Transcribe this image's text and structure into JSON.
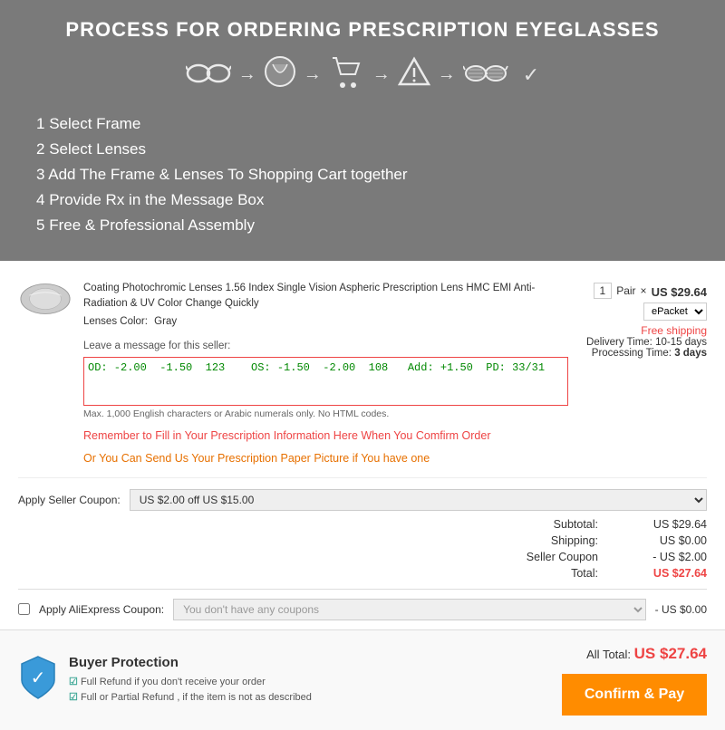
{
  "header": {
    "title": "PROCESS FOR ORDERING PRESCRIPTION EYEGLASSES",
    "steps": [
      {
        "label": "Select Frame",
        "number": "1"
      },
      {
        "label": "Select Lenses",
        "number": "2"
      },
      {
        "label": "Add The Frame & Lenses To Shopping Cart together",
        "number": "3"
      },
      {
        "label": "Provide Rx in the Message Box",
        "number": "4"
      },
      {
        "label": "Free & Professional Assembly",
        "number": "5"
      }
    ]
  },
  "product": {
    "name": "Coating Photochromic Lenses 1.56 Index Single Vision Aspheric Prescription Lens HMC EMI Anti-Radiation & UV Color Change Quickly",
    "lenses_color_label": "Lenses Color:",
    "lenses_color": "Gray",
    "qty": "1",
    "unit": "Pair",
    "price": "US $29.64",
    "shipping_method": "ePacket",
    "free_shipping": "Free shipping",
    "delivery_label": "Delivery Time:",
    "delivery_time": "10-15 days",
    "processing_label": "Processing Time:",
    "processing_time": "3 days"
  },
  "message": {
    "label": "Leave a message for this seller:",
    "content": "OD: -2.00  -1.50  123    OS: -1.50  -2.00  108   Add: +1.50  PD: 33/31",
    "hint": "Max. 1,000 English characters or Arabic numerals only. No HTML codes."
  },
  "warnings": {
    "fill_prescription": "Remember to Fill in Your Prescription Information Here When You Comfirm Order",
    "send_paper": "Or You Can Send Us Your Prescription Paper Picture if You have one"
  },
  "coupon": {
    "label": "Apply Seller Coupon:",
    "value": "US $2.00 off US $15.00"
  },
  "totals": {
    "subtotal_label": "Subtotal:",
    "subtotal": "US $29.64",
    "shipping_label": "Shipping:",
    "shipping": "US $0.00",
    "coupon_label": "Seller Coupon",
    "coupon": "- US $2.00",
    "total_label": "Total:",
    "total": "US $27.64"
  },
  "ali_coupon": {
    "label": "Apply AliExpress Coupon:",
    "placeholder": "You don't have any coupons",
    "discount": "- US $0.00"
  },
  "footer": {
    "buyer_protection_title": "Buyer Protection",
    "refund1": "Full Refund if you don't receive your order",
    "refund2": "Full or Partial Refund , if the item is not as described",
    "all_total_label": "All Total:",
    "all_total": "US $27.64",
    "confirm_button": "Confirm & Pay"
  }
}
